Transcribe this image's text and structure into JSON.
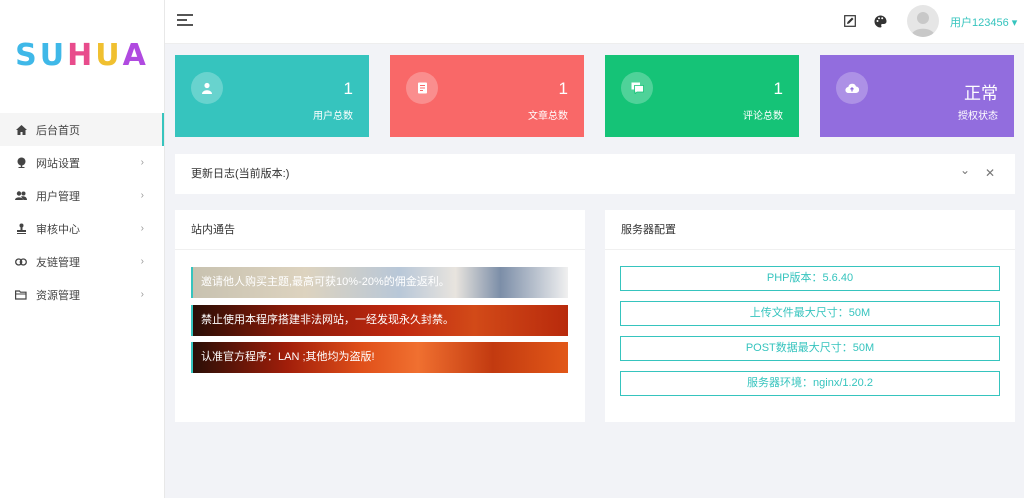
{
  "logo": {
    "letters": [
      "S",
      "U",
      "H",
      "U",
      "A"
    ],
    "colors": [
      "#3fb8e8",
      "#3fb8e8",
      "#e84c8c",
      "#f0c030",
      "#b04ae0"
    ]
  },
  "sidebar": {
    "items": [
      {
        "label": "后台首页",
        "icon": "home-icon",
        "active": true,
        "arrow": ""
      },
      {
        "label": "网站设置",
        "icon": "globe-icon",
        "active": false,
        "arrow": "›"
      },
      {
        "label": "用户管理",
        "icon": "users-icon",
        "active": false,
        "arrow": "›"
      },
      {
        "label": "审核中心",
        "icon": "stamp-icon",
        "active": false,
        "arrow": "›"
      },
      {
        "label": "友链管理",
        "icon": "link-icon",
        "active": false,
        "arrow": "›"
      },
      {
        "label": "资源管理",
        "icon": "folder-icon",
        "active": false,
        "arrow": "›"
      }
    ]
  },
  "header": {
    "username": "用户123456 ▾",
    "icons": [
      "edit-icon",
      "palette-icon"
    ]
  },
  "stats": [
    {
      "value": "1",
      "label": "用户总数",
      "icon": "user-icon",
      "color": "#36c4be"
    },
    {
      "value": "1",
      "label": "文章总数",
      "icon": "article-icon",
      "color": "#f96868"
    },
    {
      "value": "1",
      "label": "评论总数",
      "icon": "comment-icon",
      "color": "#15c377"
    },
    {
      "value": "正常",
      "label": "授权状态",
      "icon": "cloud-icon",
      "color": "#926dde"
    }
  ],
  "changelog": {
    "title": "更新日志(当前版本:)",
    "collapse": "⌄",
    "close": "✕"
  },
  "notices": {
    "title": "站内通告",
    "items": [
      "邀请他人购买主题,最高可获10%-20%的佣金返利。",
      "禁止使用本程序搭建非法网站，一经发现永久封禁。",
      "认准官方程序：LAN ;其他均为盗版!"
    ]
  },
  "server": {
    "title": "服务器配置",
    "rows": [
      "PHP版本：5.6.40",
      "上传文件最大尺寸：50M",
      "POST数据最大尺寸：50M",
      "服务器环境：nginx/1.20.2"
    ]
  }
}
